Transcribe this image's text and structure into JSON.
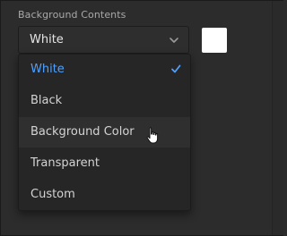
{
  "section": {
    "label": "Background Contents"
  },
  "dropdown": {
    "selected_value": "White",
    "options": [
      {
        "label": "White",
        "selected": true
      },
      {
        "label": "Black",
        "selected": false
      },
      {
        "label": "Background Color",
        "selected": false
      },
      {
        "label": "Transparent",
        "selected": false
      },
      {
        "label": "Custom",
        "selected": false
      }
    ],
    "hovered_option": "Background Color"
  },
  "swatch": {
    "color": "#ffffff"
  },
  "colors": {
    "accent": "#4fa0ff",
    "panel_bg": "#2c2c2c",
    "menu_bg": "#262626",
    "hover_bg": "#2f2f2f",
    "text_primary": "#d4d4d4",
    "text_label": "#a9a9a9"
  },
  "icons": {
    "chevron": "chevron-down-icon",
    "check": "checkmark-icon",
    "cursor": "hand-pointer-cursor-icon"
  }
}
